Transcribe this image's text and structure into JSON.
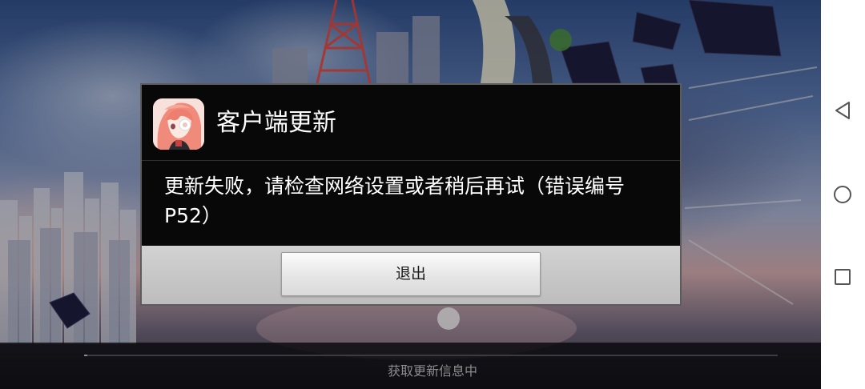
{
  "app": {
    "icon": "anime-girl-app-icon"
  },
  "dialog": {
    "title": "客户端更新",
    "message": "更新失败，请检查网络设置或者稍后再试（错误编号P52）",
    "exit_button_label": "退出"
  },
  "loading": {
    "status_text": "获取更新信息中",
    "progress": 0.005
  },
  "navbar": {
    "back_icon": "back-triangle-icon",
    "home_icon": "home-circle-icon",
    "recents_icon": "recents-square-icon",
    "background_color": "#ffffff",
    "icon_color": "#555555"
  },
  "colors": {
    "dialog_background": "#080808",
    "dialog_border": "#5c5c5c",
    "footer_background": "#c8c8c8",
    "text_primary": "#ffffff"
  }
}
